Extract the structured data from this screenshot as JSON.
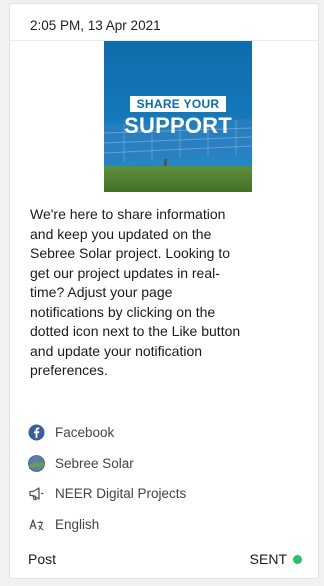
{
  "post": {
    "timestamp": "2:05 PM, 13 Apr 2021",
    "image": {
      "tagline": "SHARE YOUR",
      "title": "SUPPORT"
    },
    "message_lines": [
      "We're here to share information",
      "and keep you updated on the",
      "Sebree Solar project. Looking to",
      "get our project updates in real-",
      "time? Adjust your page",
      "notifications by clicking on the",
      "dotted icon next to the Like button",
      "and update your notification",
      "preferences."
    ],
    "meta": {
      "network": {
        "label": "Facebook",
        "icon": "facebook-icon"
      },
      "page": {
        "label": "Sebree Solar",
        "icon": "page-avatar-icon"
      },
      "project": {
        "label": "NEER Digital Projects",
        "icon": "megaphone-icon"
      },
      "language": {
        "label": "English",
        "icon": "translate-icon"
      }
    },
    "footer": {
      "type_label": "Post",
      "status_label": "SENT",
      "status_color": "#2dbd6e"
    }
  },
  "colors": {
    "facebook_blue": "#3b5d9a",
    "promo_blue": "#0f6cab"
  }
}
